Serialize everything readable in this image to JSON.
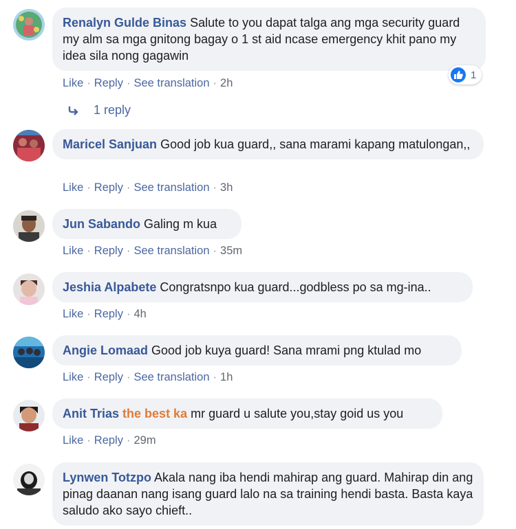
{
  "comments": [
    {
      "author": "Renalyn Gulde Binas",
      "text": "Salute to you dapat talga ang mga security guard my alm sa mga gnitong bagay o 1 st aid ncase emergency khit pano my idea sila nong gagawin",
      "actions": [
        "Like",
        "Reply",
        "See translation"
      ],
      "time": "2h",
      "reaction_count": "1",
      "replies_label": "1 reply"
    },
    {
      "author": "Maricel Sanjuan",
      "text": "Good job kua guard,, sana marami kapang matulongan,,",
      "actions": [
        "Like",
        "Reply",
        "See translation"
      ],
      "time": "3h"
    },
    {
      "author": "Jun Sabando",
      "text": "Galing m kua",
      "actions": [
        "Like",
        "Reply",
        "See translation"
      ],
      "time": "35m"
    },
    {
      "author": "Jeshia Alpabete",
      "text": "Congratsnpo kua guard...godbless po sa mg-ina..",
      "actions": [
        "Like",
        "Reply"
      ],
      "time": "4h"
    },
    {
      "author": "Angie Lomaad",
      "text": "Good job kuya guard! Sana mrami png ktulad mo",
      "actions": [
        "Like",
        "Reply",
        "See translation"
      ],
      "time": "1h"
    },
    {
      "author": "Anit Trias",
      "mention": "the best ka",
      "text": "mr guard u salute you,stay goid us you",
      "actions": [
        "Like",
        "Reply"
      ],
      "time": "29m"
    },
    {
      "author": "Lynwen Totzpo",
      "text": "Akala nang iba hendi mahirap ang guard. Mahirap din ang pinag daanan nang isang guard lalo na sa training hendi basta. Basta kaya saludo ako sayo chieft.."
    }
  ],
  "colors": {
    "author": "#385898",
    "link": "#4b67a1",
    "mention": "#e07b39",
    "bubble": "#f0f2f5",
    "like_blue": "#1877f2"
  },
  "icons": {
    "reaction": "like-thumb-icon",
    "reply": "reply-arrow-icon"
  }
}
